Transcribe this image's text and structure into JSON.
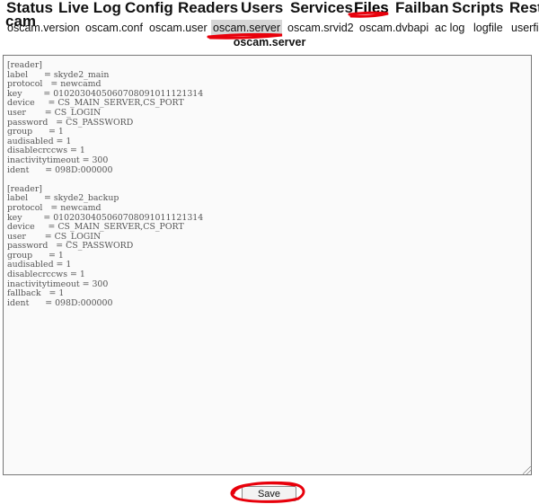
{
  "main_menu": {
    "items": [
      {
        "label": "Status"
      },
      {
        "label": "Live Log"
      },
      {
        "label": "Config"
      },
      {
        "label": "Readers"
      },
      {
        "label": "Users"
      },
      {
        "label": "Services"
      },
      {
        "label": "Files",
        "active": true
      },
      {
        "label": "Failban"
      },
      {
        "label": "Scripts"
      },
      {
        "label": "Rest"
      }
    ],
    "overflow_label": "cam"
  },
  "sub_menu": {
    "items": [
      {
        "label": "oscam.version"
      },
      {
        "label": "oscam.conf"
      },
      {
        "label": "oscam.user"
      },
      {
        "label": "oscam.server",
        "active": true
      },
      {
        "label": "oscam.srvid2"
      },
      {
        "label": "oscam.dvbapi"
      },
      {
        "label": "ac log"
      },
      {
        "label": "logfile"
      },
      {
        "label": "userfil"
      }
    ]
  },
  "file": {
    "name": "oscam.server",
    "content": "[reader]\nlabel      = skyde2_main\nprotocol   = newcamd\nkey        = 0102030405060708091011121314\ndevice     = CS_MAIN_SERVER,CS_PORT\nuser       = CS_LOGIN\npassword   = CS_PASSWORD\ngroup      = 1\naudisabled = 1\ndisablecrccws = 1\ninactivitytimeout = 300\nident      = 098D:000000\n\n[reader]\nlabel      = skyde2_backup\nprotocol   = newcamd\nkey        = 0102030405060708091011121314\ndevice     = CS_MAIN_SERVER,CS_PORT\nuser       = CS_LOGIN\npassword   = CS_PASSWORD\ngroup      = 1\naudisabled = 1\ndisablecrccws = 1\ninactivitytimeout = 300\nfallback   = 1\nident      = 098D:000000"
  },
  "actions": {
    "save_label": "Save"
  },
  "colors": {
    "annotation": "#e8000b",
    "active_tab_bg": "#d6d6d6"
  }
}
